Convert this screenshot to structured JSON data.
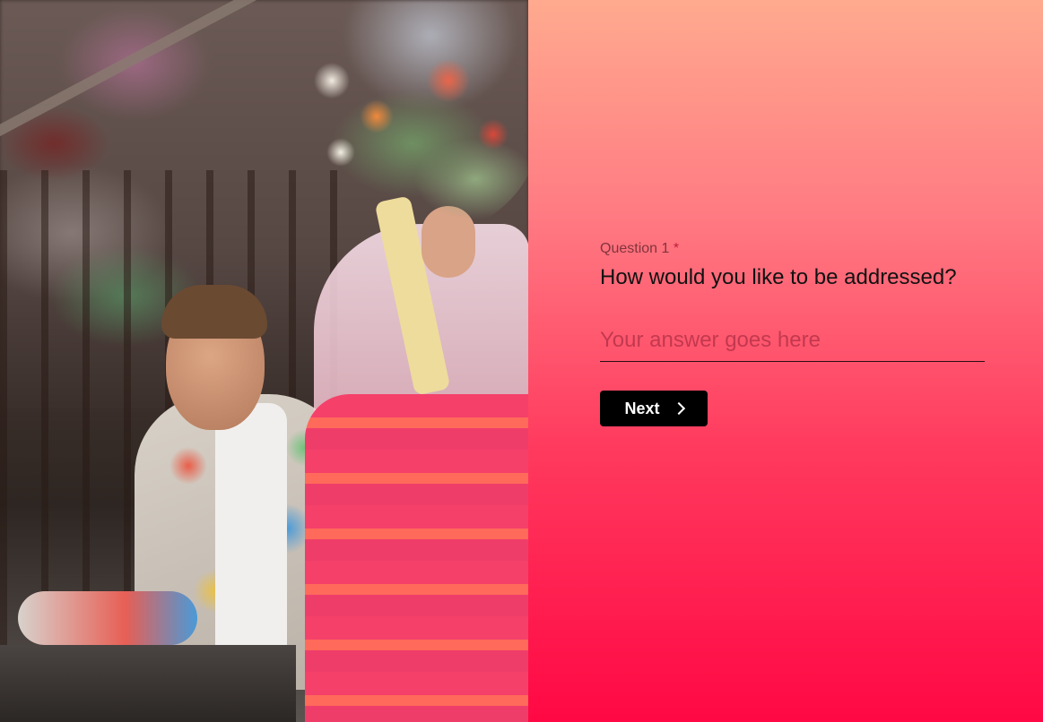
{
  "hero_image": {
    "alt": "Couple holding a flower bouquet"
  },
  "question": {
    "label": "Question 1",
    "required_marker": "*",
    "text": "How would you like to be addressed?"
  },
  "answer": {
    "placeholder": "Your answer goes here",
    "value": ""
  },
  "next_button": {
    "label": "Next",
    "icon": "chevron-right-icon"
  },
  "colors": {
    "button_background": "#000000",
    "gradient_top": "#ffaa8f",
    "gradient_bottom": "#ff0844"
  }
}
